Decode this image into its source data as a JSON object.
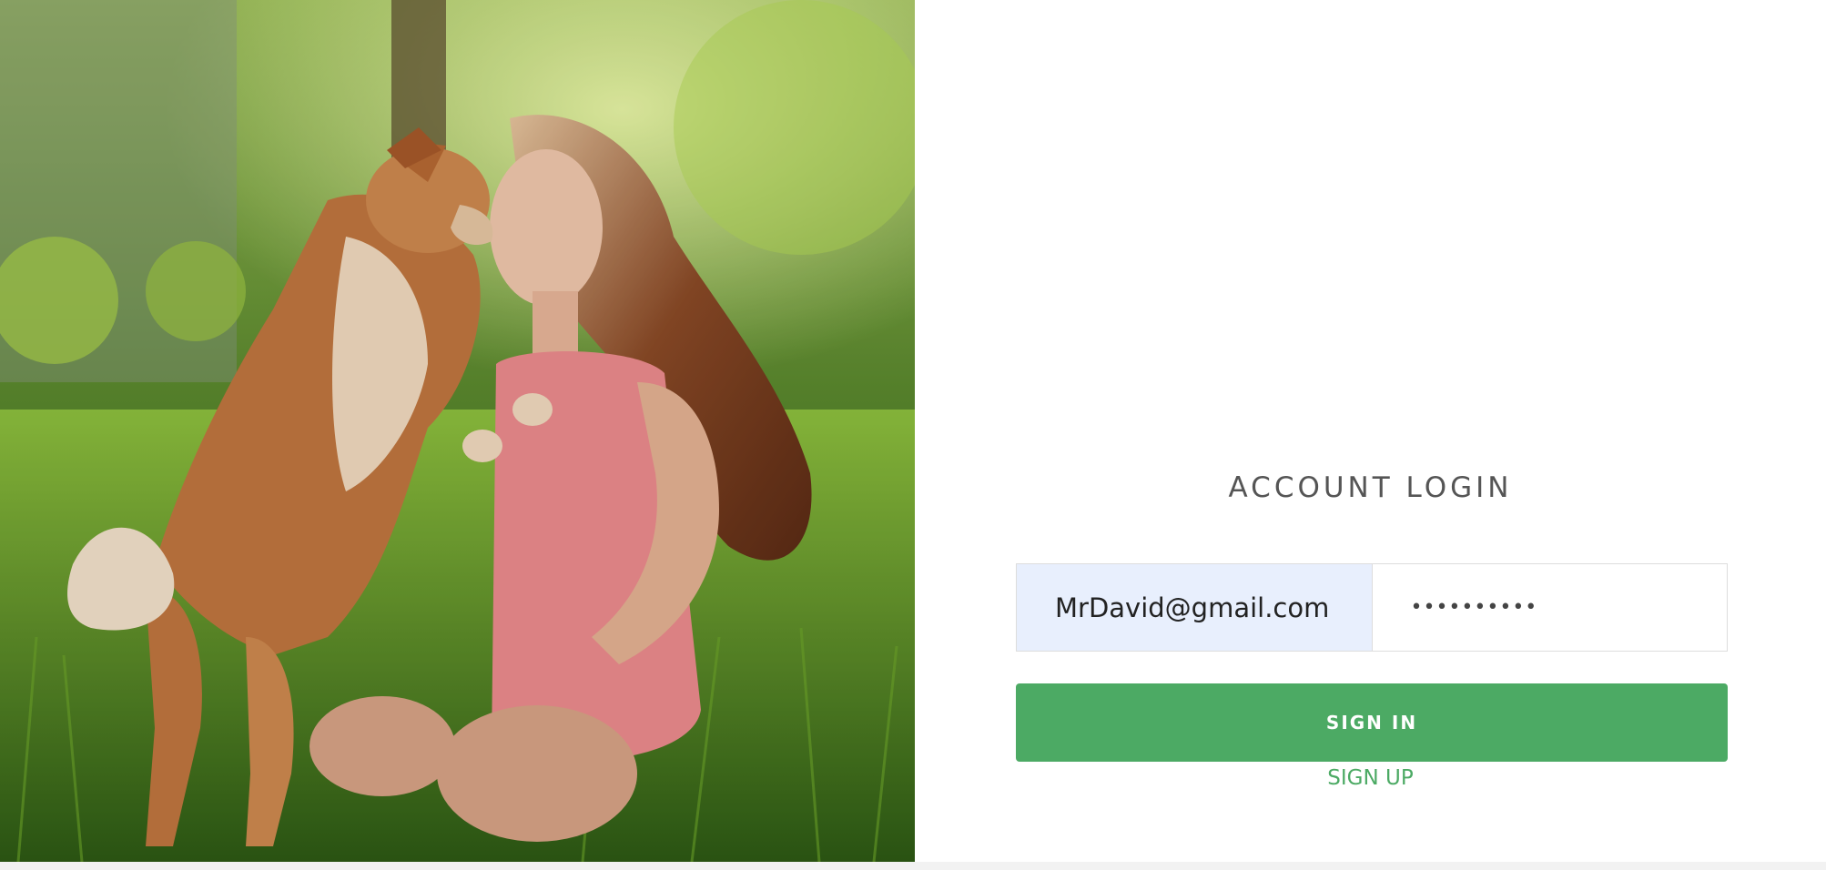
{
  "hero": {
    "image_description": "woman-and-dog-photo"
  },
  "login": {
    "title": "ACCOUNT LOGIN",
    "email_value": "MrDavid@gmail.com",
    "password_value": "••••••••••",
    "signin_label": "SIGN IN",
    "signup_label": "SIGN UP"
  },
  "colors": {
    "accent": "#4caa64",
    "email_bg": "#e8effd",
    "title": "#555555"
  }
}
